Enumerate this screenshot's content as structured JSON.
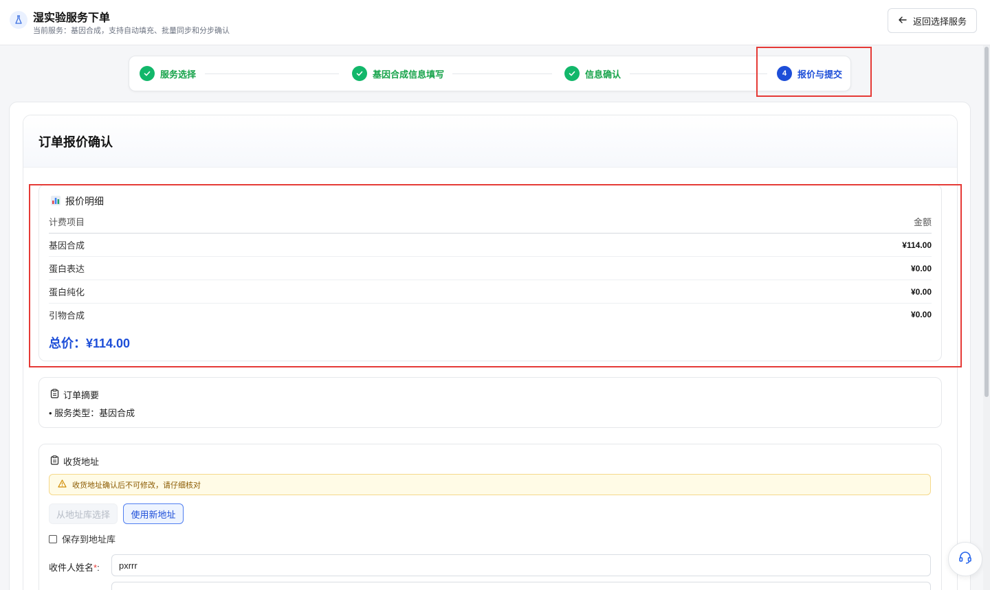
{
  "header": {
    "title": "湿实验服务下单",
    "subtitle": "当前服务：基因合成，支持自动填充、批量同步和分步确认",
    "back_label": "返回选择服务",
    "icon": "flask-icon"
  },
  "stepper": {
    "steps": [
      {
        "label": "服务选择",
        "status": "done"
      },
      {
        "label": "基因合成信息填写",
        "status": "done"
      },
      {
        "label": "信息确认",
        "status": "done"
      },
      {
        "label": "报价与提交",
        "status": "active",
        "number": "4"
      }
    ]
  },
  "page": {
    "title": "订单报价确认"
  },
  "quote": {
    "title": "报价明细",
    "icon": "bar-chart-icon",
    "columns": [
      "计费项目",
      "金额"
    ],
    "rows": [
      {
        "item": "基因合成",
        "amount": "¥114.00"
      },
      {
        "item": "蛋白表达",
        "amount": "¥0.00"
      },
      {
        "item": "蛋白纯化",
        "amount": "¥0.00"
      },
      {
        "item": "引物合成",
        "amount": "¥0.00"
      }
    ],
    "total": "总价：¥114.00"
  },
  "summary": {
    "title": "订单摘要",
    "items": [
      "• 服务类型：基因合成"
    ]
  },
  "address": {
    "title": "收货地址",
    "warning": "收货地址确认后不可修改，请仔细核对",
    "from_library_label": "从地址库选择",
    "new_address_label": "使用新地址",
    "save_to_library_label": "保存到地址库",
    "save_to_library_checked": false,
    "recipient_label": "收件人姓名",
    "recipient_required": "*",
    "recipient_colon": ":",
    "recipient_value": "pxrrr"
  },
  "colors": {
    "accent": "#1d4ed8",
    "success": "#12b76a",
    "warning_bg": "#fffbe6",
    "highlight_border": "#e53935"
  }
}
